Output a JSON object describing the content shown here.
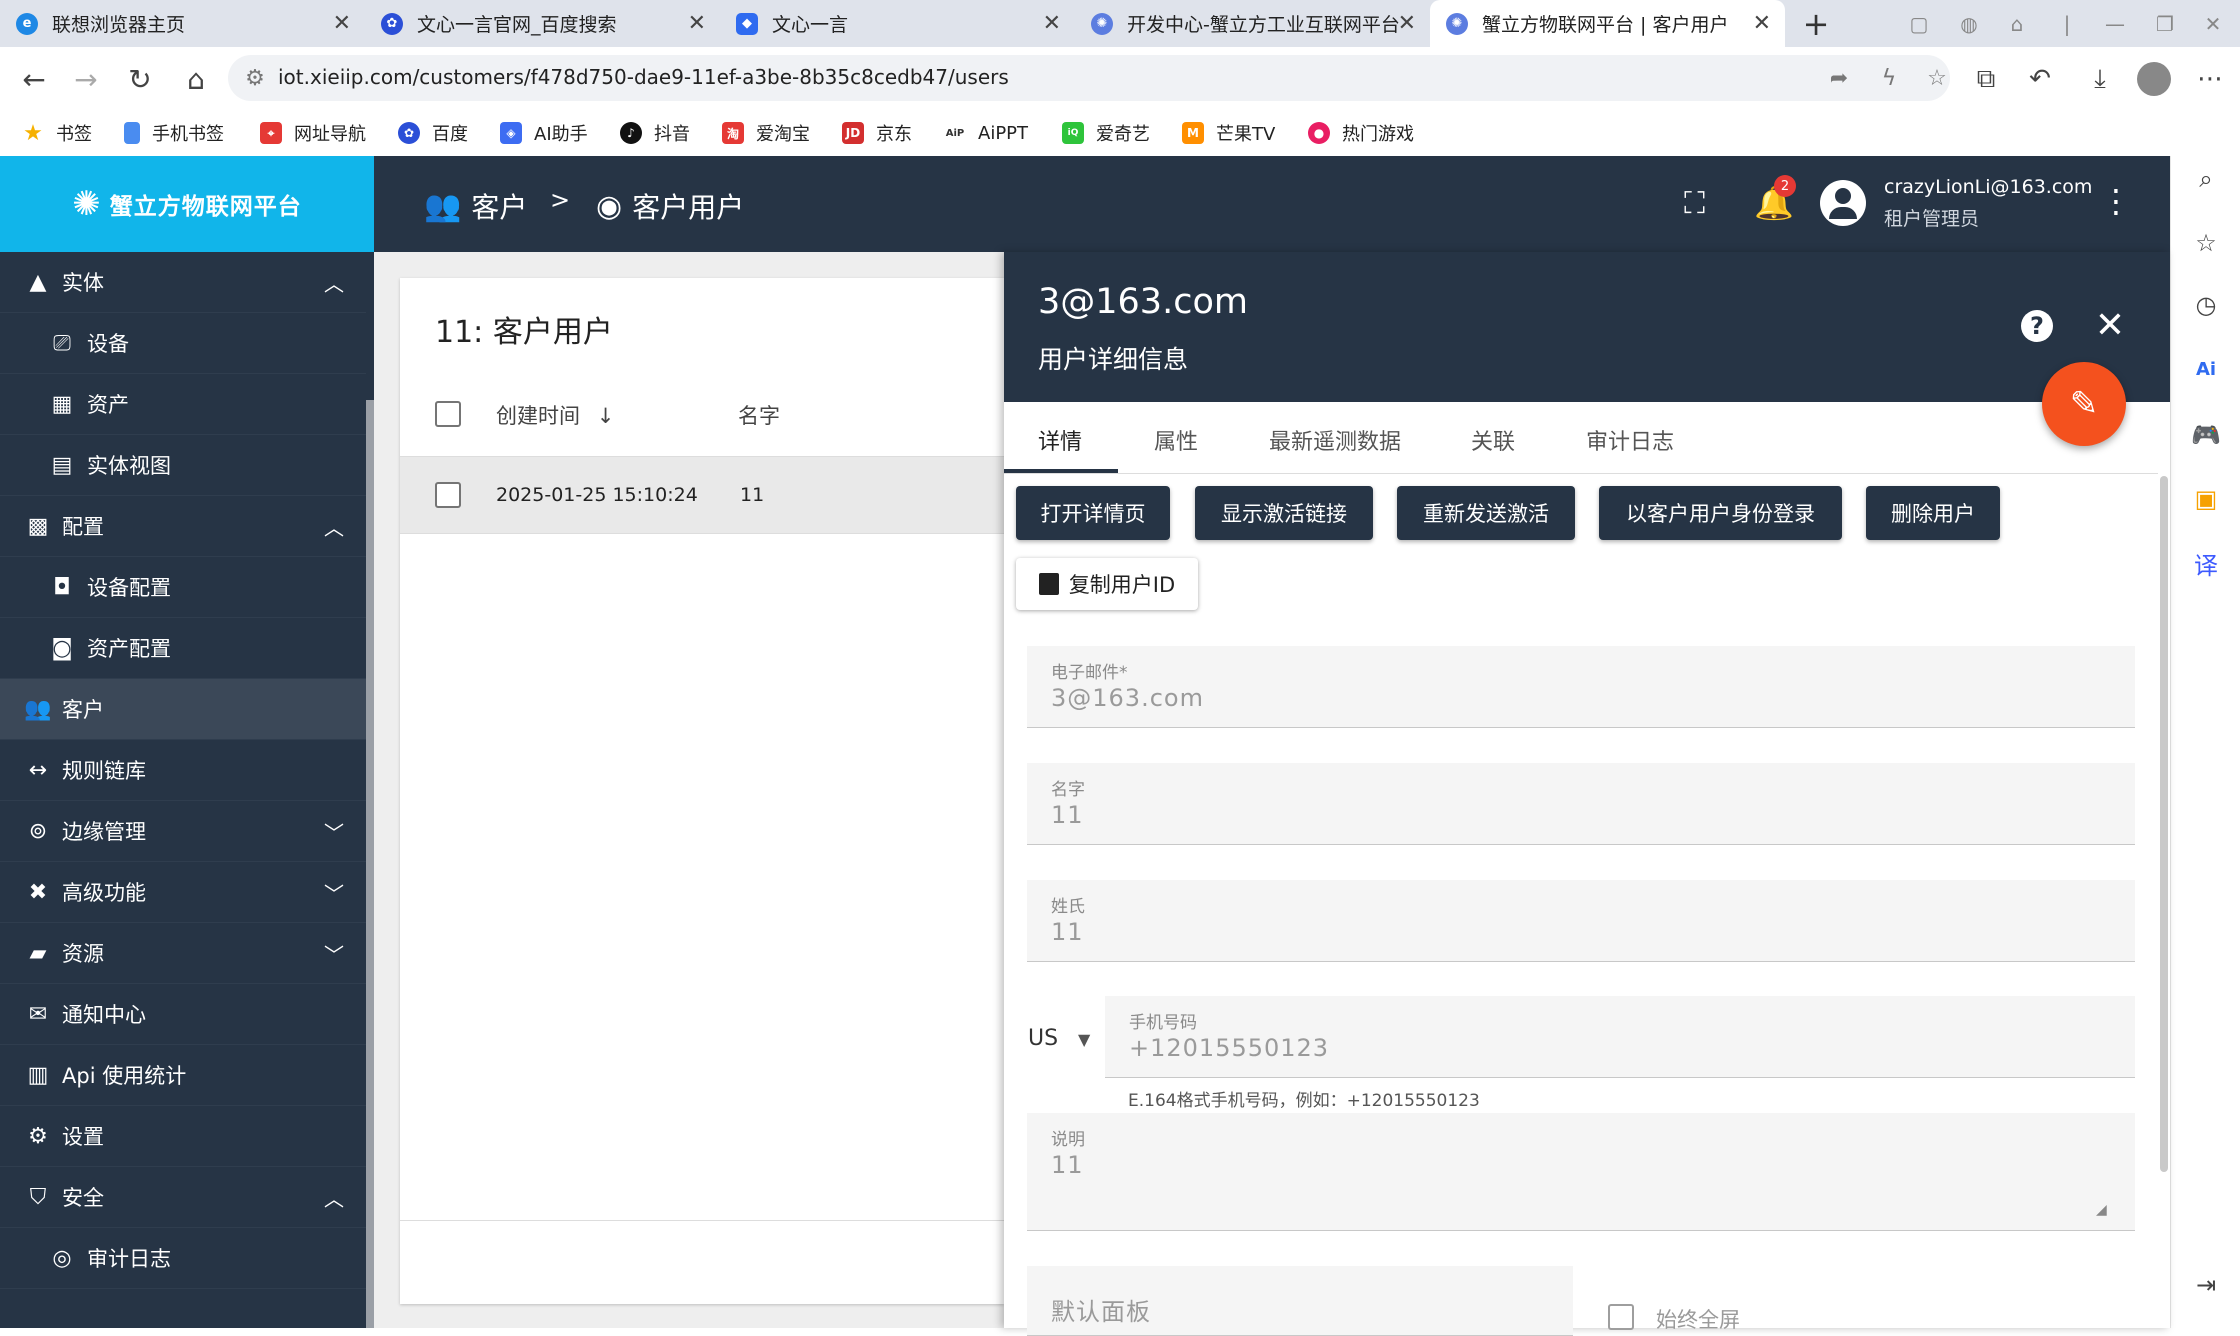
{
  "browser": {
    "tabs": [
      {
        "title": "联想浏览器主页",
        "icon": "lenovo-browser-icon",
        "active": false
      },
      {
        "title": "文心一言官网_百度搜索",
        "icon": "baidu-paw-icon",
        "active": false
      },
      {
        "title": "文心一言",
        "icon": "wenxin-icon",
        "active": false
      },
      {
        "title": "开发中心-蟹立方工业互联网平台",
        "icon": "crab-icon",
        "active": false
      },
      {
        "title": "蟹立方物联网平台 | 客户用户",
        "icon": "crab-icon",
        "active": true
      }
    ],
    "url": "iot.xieiip.com/customers/f478d750-dae9-11ef-a3be-8b35c8cedb47/users",
    "bookmarks": [
      {
        "label": "书签",
        "icon": "star-icon"
      },
      {
        "label": "手机书签",
        "icon": "phone-icon"
      },
      {
        "label": "网址导航",
        "icon": "nav-icon"
      },
      {
        "label": "百度",
        "icon": "baidu-paw-icon"
      },
      {
        "label": "AI助手",
        "icon": "ai-assistant-icon"
      },
      {
        "label": "抖音",
        "icon": "douyin-icon"
      },
      {
        "label": "爱淘宝",
        "icon": "taobao-icon"
      },
      {
        "label": "京东",
        "icon": "jd-icon"
      },
      {
        "label": "AiPPT",
        "icon": "aippt-icon"
      },
      {
        "label": "爱奇艺",
        "icon": "iqiyi-icon"
      },
      {
        "label": "芒果TV",
        "icon": "mango-tv-icon"
      },
      {
        "label": "热门游戏",
        "icon": "games-icon"
      }
    ]
  },
  "app": {
    "logo_text": "蟹立方物联网平台",
    "breadcrumb": [
      {
        "label": "客户",
        "icon": "people-icon"
      },
      {
        "label": "客户用户",
        "icon": "account-circle-icon"
      }
    ],
    "breadcrumb_separator": ">",
    "notifications_count": "2",
    "user": {
      "email": "crazyLionLi@163.com",
      "role": "租户管理员"
    }
  },
  "nav": {
    "items": [
      {
        "label": "实体",
        "icon": "entity-icon",
        "chevron": "up",
        "sub": false
      },
      {
        "label": "设备",
        "icon": "device-icon",
        "sub": true
      },
      {
        "label": "资产",
        "icon": "asset-icon",
        "sub": true
      },
      {
        "label": "实体视图",
        "icon": "entity-view-icon",
        "sub": true
      },
      {
        "label": "配置",
        "icon": "profiles-icon",
        "chevron": "up",
        "sub": false
      },
      {
        "label": "设备配置",
        "icon": "device-profile-icon",
        "sub": true
      },
      {
        "label": "资产配置",
        "icon": "asset-profile-icon",
        "sub": true
      },
      {
        "label": "客户",
        "icon": "customers-icon",
        "sub": false,
        "selected": true
      },
      {
        "label": "规则链库",
        "icon": "rule-chain-icon",
        "sub": false
      },
      {
        "label": "边缘管理",
        "icon": "edge-icon",
        "chevron": "down",
        "sub": false
      },
      {
        "label": "高级功能",
        "icon": "advanced-icon",
        "chevron": "down",
        "sub": false
      },
      {
        "label": "资源",
        "icon": "folder-icon",
        "chevron": "down",
        "sub": false
      },
      {
        "label": "通知中心",
        "icon": "notification-center-icon",
        "sub": false
      },
      {
        "label": "Api 使用统计",
        "icon": "api-usage-icon",
        "sub": false
      },
      {
        "label": "设置",
        "icon": "settings-icon",
        "sub": false
      },
      {
        "label": "安全",
        "icon": "security-icon",
        "chevron": "up",
        "sub": false
      },
      {
        "label": "审计日志",
        "icon": "audit-log-icon",
        "sub": true
      }
    ]
  },
  "list": {
    "title": "11: 客户用户",
    "columns": [
      "创建时间",
      "名字"
    ],
    "rows": [
      {
        "created": "2025-01-25 15:10:24",
        "name": "11"
      }
    ]
  },
  "detail": {
    "title": "3@163.com",
    "subtitle": "用户详细信息",
    "tabs": [
      "详情",
      "属性",
      "最新遥测数据",
      "关联",
      "审计日志"
    ],
    "active_tab": "详情",
    "actions": [
      "打开详情页",
      "显示激活链接",
      "重新发送激活",
      "以客户用户身份登录",
      "删除用户"
    ],
    "copy_id_label": "复制用户ID",
    "fields": {
      "email": {
        "label": "电子邮件*",
        "value": "3@163.com"
      },
      "first_name": {
        "label": "名字",
        "value": "11"
      },
      "last_name": {
        "label": "姓氏",
        "value": "11"
      },
      "phone": {
        "country": "US",
        "label": "手机号码",
        "value": "+12015550123",
        "hint": "E.164格式手机号码，例如：+12015550123"
      },
      "description": {
        "label": "说明",
        "value": "11"
      },
      "default_dashboard": {
        "placeholder": "默认面板"
      },
      "always_fullscreen": {
        "label": "始终全屏",
        "checked": false
      }
    }
  }
}
